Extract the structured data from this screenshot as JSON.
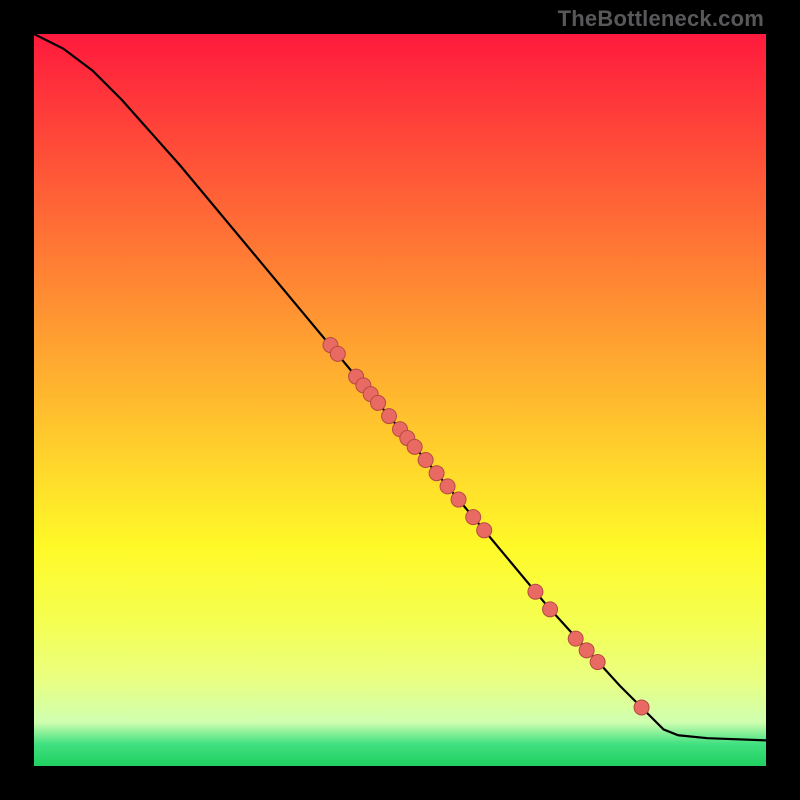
{
  "watermark": "TheBottleneck.com",
  "chart_data": {
    "type": "line",
    "title": "",
    "xlabel": "",
    "ylabel": "",
    "xlim": [
      0,
      100
    ],
    "ylim": [
      0,
      100
    ],
    "grid": false,
    "legend": false,
    "background": "gradient:red-yellow-green",
    "curve": [
      {
        "x": 0,
        "y": 100
      },
      {
        "x": 4,
        "y": 98
      },
      {
        "x": 8,
        "y": 95
      },
      {
        "x": 12,
        "y": 91
      },
      {
        "x": 16,
        "y": 86.5
      },
      {
        "x": 20,
        "y": 82
      },
      {
        "x": 30,
        "y": 70
      },
      {
        "x": 40,
        "y": 58
      },
      {
        "x": 50,
        "y": 46
      },
      {
        "x": 60,
        "y": 34
      },
      {
        "x": 70,
        "y": 22
      },
      {
        "x": 80,
        "y": 11
      },
      {
        "x": 86,
        "y": 5
      },
      {
        "x": 88,
        "y": 4.2
      },
      {
        "x": 92,
        "y": 3.8
      },
      {
        "x": 100,
        "y": 3.5
      }
    ],
    "points": [
      {
        "x": 40.5,
        "y": 57.5
      },
      {
        "x": 41.5,
        "y": 56.3
      },
      {
        "x": 44.0,
        "y": 53.2
      },
      {
        "x": 45.0,
        "y": 52.0
      },
      {
        "x": 46.0,
        "y": 50.8
      },
      {
        "x": 47.0,
        "y": 49.6
      },
      {
        "x": 48.5,
        "y": 47.8
      },
      {
        "x": 50.0,
        "y": 46.0
      },
      {
        "x": 51.0,
        "y": 44.8
      },
      {
        "x": 52.0,
        "y": 43.6
      },
      {
        "x": 53.5,
        "y": 41.8
      },
      {
        "x": 55.0,
        "y": 40.0
      },
      {
        "x": 56.5,
        "y": 38.2
      },
      {
        "x": 58.0,
        "y": 36.4
      },
      {
        "x": 60.0,
        "y": 34.0
      },
      {
        "x": 61.5,
        "y": 32.2
      },
      {
        "x": 68.5,
        "y": 23.8
      },
      {
        "x": 70.5,
        "y": 21.4
      },
      {
        "x": 74.0,
        "y": 17.4
      },
      {
        "x": 75.5,
        "y": 15.8
      },
      {
        "x": 77.0,
        "y": 14.2
      },
      {
        "x": 83.0,
        "y": 8.0
      }
    ],
    "colors": {
      "curve": "#000000",
      "points_fill": "#e96a62",
      "points_stroke": "#b44a42"
    }
  }
}
